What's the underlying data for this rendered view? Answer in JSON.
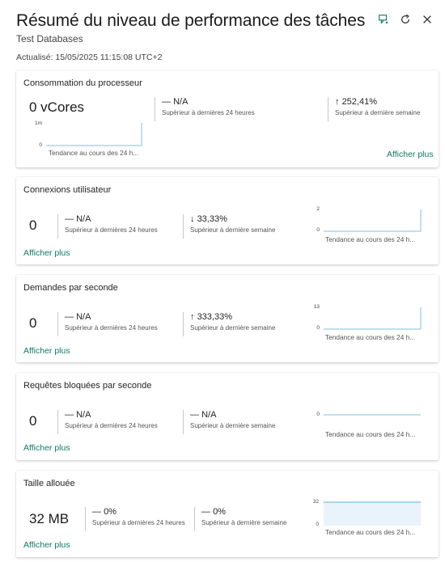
{
  "header": {
    "title": "Résumé du niveau de performance des tâches",
    "subtitle": "Test Databases",
    "updated": "Actualisé: 15/05/2025 11:15:08 UTC+2",
    "icons": [
      "feedback-icon",
      "refresh-icon",
      "close-icon"
    ]
  },
  "colors": {
    "accent_link": "#0e7a65",
    "sparkline": "#7fbfe0",
    "sparkline_fill": "#e8f3fb"
  },
  "cards": [
    {
      "title": "Consommation du processeur",
      "value": "0 vCores",
      "stat1": {
        "value": "N/A",
        "arrow": "—",
        "label": "Supérieur à dernières 24 heures"
      },
      "stat2": {
        "value": "252,41%",
        "arrow": "↑",
        "label": "Supérieur à dernière semaine"
      },
      "axis_max": "1m",
      "axis_min": "0",
      "trend_label": "Tendance au cours des 24 h...",
      "more": "Afficher plus"
    },
    {
      "title": "Connexions utilisateur",
      "value": "0",
      "stat1": {
        "value": "N/A",
        "arrow": "—",
        "label": "Supérieur à dernières 24 heures"
      },
      "stat2": {
        "value": "33,33%",
        "arrow": "↓",
        "label": "Supérieur à dernière semaine"
      },
      "axis_max": "2",
      "axis_min": "0",
      "trend_label": "Tendance au cours des 24 h...",
      "more": "Afficher plus"
    },
    {
      "title": "Demandes par seconde",
      "value": "0",
      "stat1": {
        "value": "N/A",
        "arrow": "—",
        "label": "Supérieur à dernières 24 heures"
      },
      "stat2": {
        "value": "333,33%",
        "arrow": "↑",
        "label": "Supérieur à dernière semaine"
      },
      "axis_max": "13",
      "axis_min": "0",
      "trend_label": "Tendance au cours des 24 h...",
      "more": "Afficher plus"
    },
    {
      "title": "Requêtes bloquées par seconde",
      "value": "0",
      "stat1": {
        "value": "N/A",
        "arrow": "—",
        "label": "Supérieur à dernières 24 heures"
      },
      "stat2": {
        "value": "N/A",
        "arrow": "—",
        "label": "Supérieur à dernière semaine"
      },
      "axis_max": "",
      "axis_min": "0",
      "trend_label": "Tendance au cours des 24 h...",
      "more": "Afficher plus"
    },
    {
      "title": "Taille allouée",
      "value": "32 MB",
      "stat1": {
        "value": "0%",
        "arrow": "—",
        "label": "Supérieur à dernières 24 heures"
      },
      "stat2": {
        "value": "0%",
        "arrow": "—",
        "label": "Supérieur à dernière semaine"
      },
      "axis_max": "32",
      "axis_min": "0",
      "trend_label": "Tendance au cours des 24 h...",
      "more": "Afficher plus"
    }
  ]
}
